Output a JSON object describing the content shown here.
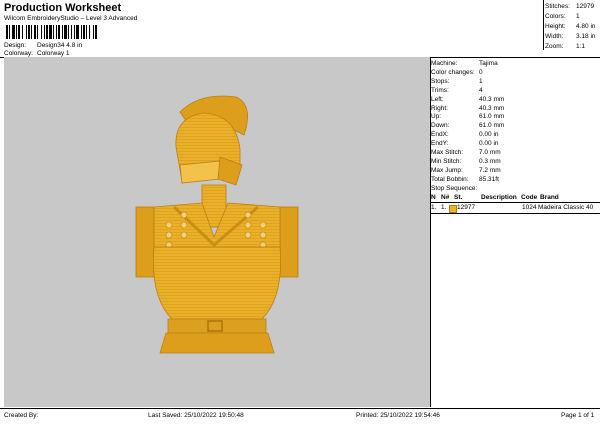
{
  "header": {
    "title": "Production Worksheet",
    "subtitle": "Wilcom EmbroideryStudio – Level 3 Advanced",
    "design_label": "Design:",
    "design_value": "Design34 4.8 in",
    "colorway_label": "Colorway:",
    "colorway_value": "Colorway 1"
  },
  "stats": [
    {
      "label": "Stitches:",
      "value": "12979"
    },
    {
      "label": "Colors:",
      "value": "1"
    },
    {
      "label": "Height:",
      "value": "4.80 in"
    },
    {
      "label": "Width:",
      "value": "3.18 in"
    },
    {
      "label": "Zoom:",
      "value": "1:1"
    }
  ],
  "machine_info": [
    {
      "label": "Machine:",
      "value": "Tajima"
    },
    {
      "label": "Color changes:",
      "value": "0"
    },
    {
      "label": "Stops:",
      "value": "1"
    },
    {
      "label": "Trims:",
      "value": "4"
    },
    {
      "label": "Left:",
      "value": "40.3 mm"
    },
    {
      "label": "Right:",
      "value": "40.3 mm"
    },
    {
      "label": "Up:",
      "value": "61.0 mm"
    },
    {
      "label": "Down:",
      "value": "61.0 mm"
    },
    {
      "label": "EndX:",
      "value": "0.00 in"
    },
    {
      "label": "EndY:",
      "value": "0.00 in"
    },
    {
      "label": "Max Stitch:",
      "value": "7.0 mm"
    },
    {
      "label": "Min Stitch:",
      "value": "0.3 mm"
    },
    {
      "label": "Max Jump:",
      "value": "7.2 mm"
    },
    {
      "label": "Total Bobbin:",
      "value": "85.31ft"
    }
  ],
  "stop_sequence": {
    "heading": "Stop Sequence:",
    "columns": {
      "n": "N",
      "nnum": "N#",
      "st": "St.",
      "description": "Description",
      "code": "Code",
      "brand": "Brand"
    },
    "rows": [
      {
        "n": "1.",
        "nnum": "1.",
        "st": "12977",
        "description": "",
        "code": "1024",
        "brand": "Madeira Classic 40",
        "color": "#f0b030"
      }
    ]
  },
  "footer": {
    "created_by": "Created By:",
    "last_saved": "Last Saved: 25/10/2022 19:50:48",
    "printed": "Printed: 25/10/2022 19:54:46",
    "page": "Page 1 of 1"
  },
  "colors": {
    "design_background": "#c8c8c8",
    "thread_gold": "#f0b030"
  }
}
